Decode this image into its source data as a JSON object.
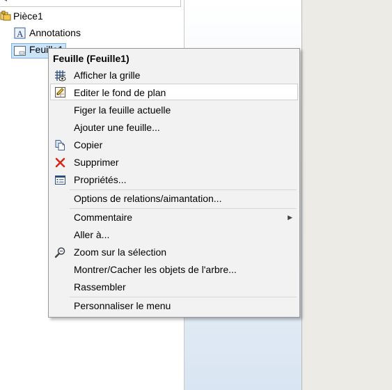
{
  "tree": {
    "root_label": "Pièce1",
    "annotations_label": "Annotations",
    "sheet_label": "Feuille1"
  },
  "context_menu": {
    "title": "Feuille (Feuille1)",
    "items": {
      "show_grid": "Afficher la grille",
      "edit_sheet_format": "Editer le fond de plan",
      "lock_sheet": "Figer la feuille actuelle",
      "add_sheet": "Ajouter une feuille...",
      "copy": "Copier",
      "delete": "Supprimer",
      "properties": "Propriétés...",
      "relations_snaps": "Options de relations/aimantation...",
      "comment": "Commentaire",
      "go_to": "Aller à...",
      "zoom_selection": "Zoom sur la sélection",
      "show_hide_tree": "Montrer/Cacher les objets de l'arbre...",
      "collapse": "Rassembler",
      "customize_menu": "Personnaliser le menu"
    }
  },
  "icons": {
    "grid": "grid-icon",
    "edit_format": "edit-sheet-format-icon",
    "copy": "copy-icon",
    "delete": "delete-x-icon",
    "properties": "properties-icon",
    "zoom": "zoom-magnifier-icon",
    "submenu": "submenu-arrow-icon"
  },
  "colors": {
    "menu_background": "#f2f2f2",
    "hover_background": "#ffffff",
    "selection_highlight": "#cce4f7",
    "delete_red": "#d42a1c",
    "right_strip": "#ecebe6"
  }
}
